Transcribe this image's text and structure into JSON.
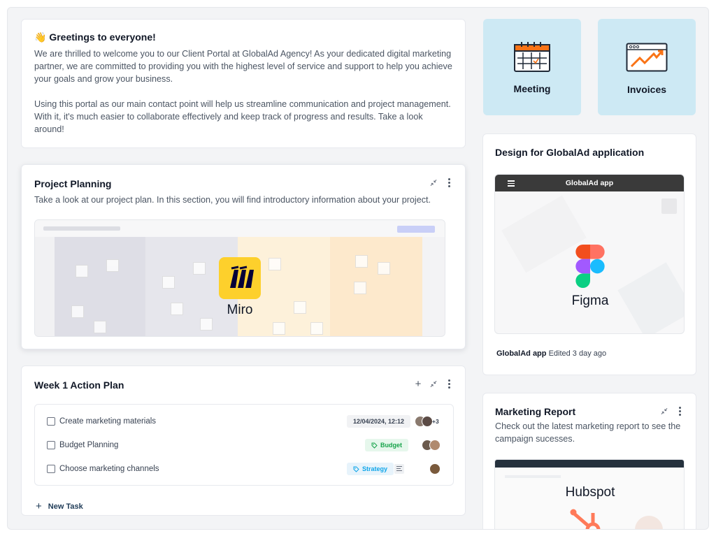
{
  "greeting": {
    "title": "👋 Greetings to everyone!",
    "paragraph_1": "We are thrilled to welcome you to our Client Portal at GlobalAd Agency! As your dedicated digital marketing partner, we are committed to providing you with the highest level of service and support to help you achieve your goals and grow your business.",
    "paragraph_2": "Using this portal as our main contact point will help us streamline communication and project management. With it, it's much easier to collaborate effectively and keep track of progress and results. Take a look around!"
  },
  "planning": {
    "title": "Project Planning",
    "description": "Take a look at our project plan. In this section, you will find introductory information about your project.",
    "embed_name": "Miro",
    "icons": [
      "collapse-icon",
      "more-icon"
    ]
  },
  "action_plan": {
    "title": "Week 1 Action Plan",
    "icons": [
      "add-icon",
      "collapse-icon",
      "more-icon"
    ],
    "tasks": [
      {
        "label": "Create marketing materials",
        "date": "12/04/2024, 12:12",
        "extra_assignees": "+3"
      },
      {
        "label": "Budget Planning",
        "tag": "Budget"
      },
      {
        "label": "Choose marketing channels",
        "tag": "Strategy"
      }
    ],
    "new_task_label": "New Task"
  },
  "tiles": [
    {
      "label": "Meeting",
      "icon": "calendar-icon"
    },
    {
      "label": "Invoices",
      "icon": "chart-growth-icon"
    }
  ],
  "figma_card": {
    "title": "Design for GlobalAd application",
    "app_bar_title": "GlobalAd app",
    "embed_name": "Figma",
    "file_name": "GlobalAd app",
    "edited": "Edited 3 day ago"
  },
  "marketing": {
    "title": "Marketing Report",
    "description": "Check out the latest marketing report to see the campaign sucesses.",
    "embed_name": "Hubspot"
  },
  "colors": {
    "tile_bg": "#cde9f4",
    "miro_yellow": "#fdd02c",
    "budget_green": "#16a34a",
    "strategy_blue": "#0ea5e9",
    "hubspot_orange": "#ff7a59"
  }
}
